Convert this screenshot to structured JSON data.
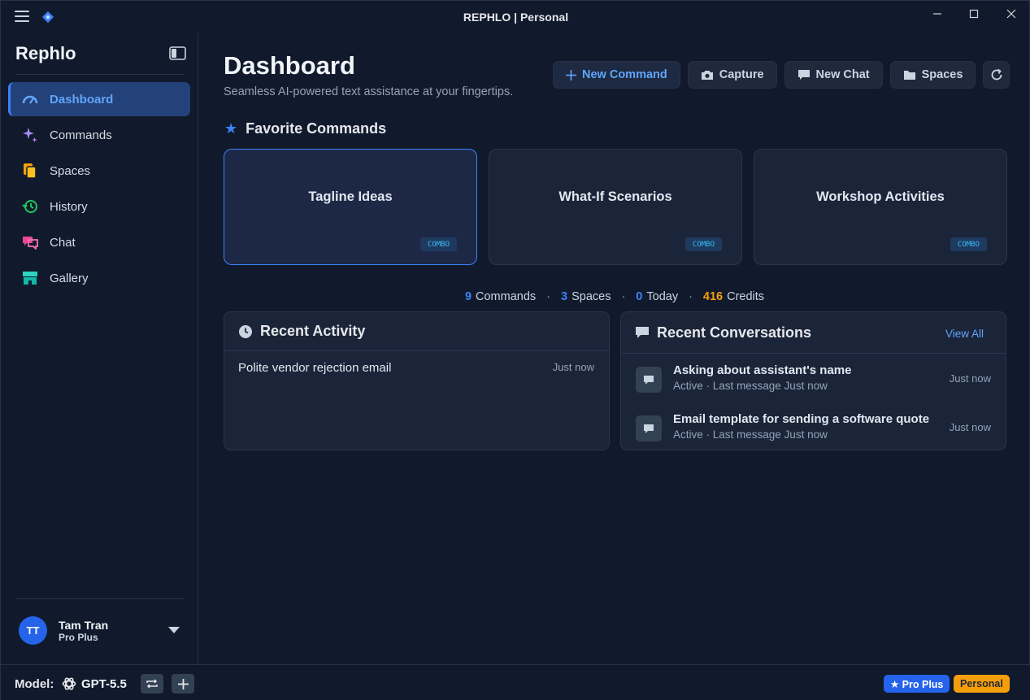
{
  "window": {
    "title": "REPHLO | Personal"
  },
  "sidebar": {
    "brand": "Rephlo",
    "items": [
      {
        "label": "Dashboard",
        "icon": "gauge-icon",
        "active": true
      },
      {
        "label": "Commands",
        "icon": "sparkles-icon"
      },
      {
        "label": "Spaces",
        "icon": "files-icon"
      },
      {
        "label": "History",
        "icon": "history-icon"
      },
      {
        "label": "Chat",
        "icon": "chat-icon"
      },
      {
        "label": "Gallery",
        "icon": "store-icon"
      }
    ],
    "user": {
      "initials": "TT",
      "name": "Tam Tran",
      "plan": "Pro Plus"
    }
  },
  "header": {
    "title": "Dashboard",
    "subtitle": "Seamless AI-powered text assistance at your fingertips."
  },
  "toolbar": {
    "new_command": "New Command",
    "capture": "Capture",
    "new_chat": "New Chat",
    "spaces": "Spaces"
  },
  "favorites": {
    "heading": "Favorite Commands",
    "cards": [
      {
        "title": "Tagline Ideas",
        "badge": "COMBO"
      },
      {
        "title": "What-If Scenarios",
        "badge": "COMBO"
      },
      {
        "title": "Workshop Activities",
        "badge": "COMBO"
      }
    ]
  },
  "stats": {
    "commands_count": "9",
    "commands_label": "Commands",
    "spaces_count": "3",
    "spaces_label": "Spaces",
    "today_count": "0",
    "today_label": "Today",
    "credits_count": "416",
    "credits_label": "Credits",
    "separator": "·"
  },
  "recent_activity": {
    "heading": "Recent Activity",
    "items": [
      {
        "title": "Polite vendor rejection email",
        "time": "Just now"
      }
    ]
  },
  "recent_conversations": {
    "heading": "Recent Conversations",
    "view_all": "View All",
    "items": [
      {
        "title": "Asking about assistant's name",
        "subtitle": "Active · Last message Just now",
        "time": "Just now"
      },
      {
        "title": "Email template for sending a software quote",
        "subtitle": "Active · Last message Just now",
        "time": "Just now"
      }
    ]
  },
  "statusbar": {
    "model_label": "Model:",
    "model_name": "GPT-5.5",
    "plan_badge": "★ Pro Plus",
    "profile_badge": "Personal"
  },
  "colors": {
    "accent": "#3b82f6",
    "credits": "#f59e0b",
    "background": "#111a2c"
  }
}
